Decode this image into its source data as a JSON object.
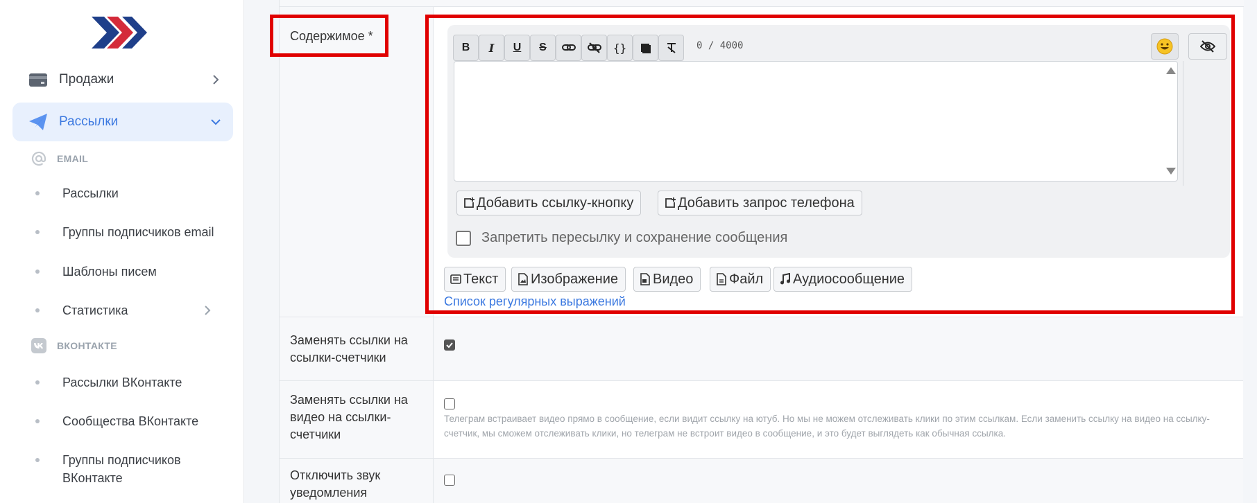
{
  "sidebar": {
    "logo": "brand-logo",
    "items": [
      {
        "label": "Продажи",
        "icon": "credit-card-icon",
        "expanded": false
      },
      {
        "label": "Рассылки",
        "icon": "paper-plane-icon",
        "expanded": true,
        "active": true
      }
    ],
    "sections": [
      {
        "title": "EMAIL",
        "icon": "at-sign-icon",
        "items": [
          "Рассылки",
          "Группы подписчиков email",
          "Шаблоны писем",
          "Статистика"
        ]
      },
      {
        "title": "ВКОНТАКТЕ",
        "icon": "vk-icon",
        "items": [
          "Рассылки ВКонтакте",
          "Сообщества ВКонтакте",
          "Группы подписчиков ВКонтакте"
        ]
      }
    ]
  },
  "form": {
    "content": {
      "label": "Содержимое *",
      "counter": "0 / 4000",
      "toolbar": [
        {
          "label": "B",
          "icon": "bold-icon"
        },
        {
          "label": "I",
          "icon": "italic-icon"
        },
        {
          "label": "U",
          "icon": "underline-icon"
        },
        {
          "label": "S",
          "icon": "strikethrough-icon"
        },
        {
          "label": "",
          "icon": "link-icon"
        },
        {
          "label": "",
          "icon": "unlink-icon"
        },
        {
          "label": "{}",
          "icon": "code-icon"
        },
        {
          "label": "",
          "icon": "spoiler-icon"
        },
        {
          "label": "",
          "icon": "clear-format-icon"
        }
      ],
      "textarea_value": "",
      "add_link_button": "Добавить ссылку-кнопку",
      "add_phone_button": "Добавить запрос телефона",
      "forbid_forward_label": "Запретить пересылку и сохранение сообщения",
      "forbid_forward_checked": false,
      "types": [
        {
          "label": "Текст",
          "icon": "text-icon"
        },
        {
          "label": "Изображение",
          "icon": "image-file-icon"
        },
        {
          "label": "Видео",
          "icon": "video-file-icon"
        },
        {
          "label": "Файл",
          "icon": "file-icon"
        },
        {
          "label": "Аудиосообщение",
          "icon": "music-note-icon"
        }
      ],
      "regex_link": "Список регулярных выражений"
    },
    "replace_links": {
      "label": "Заменять ссылки на ссылки-счетчики",
      "checked": true
    },
    "replace_video_links": {
      "label": "Заменять ссылки на видео на ссылки-счетчики",
      "checked": false,
      "hint": "Телеграм встраивает видео прямо в сообщение, если видит ссылку на ютуб. Но мы не можем отслеживать клики по этим ссылкам. Если заменить ссылку на видео на ссылку-счетчик, мы сможем отслеживать клики, но телеграм не встроит видео в сообщение, и это будет выглядеть как обычная ссылка."
    },
    "mute": {
      "label": "Отключить звук уведомления",
      "checked": false
    }
  },
  "colors": {
    "accent": "#3c79e0",
    "highlight": "#e00000",
    "active_bg": "#e8f0fd"
  }
}
